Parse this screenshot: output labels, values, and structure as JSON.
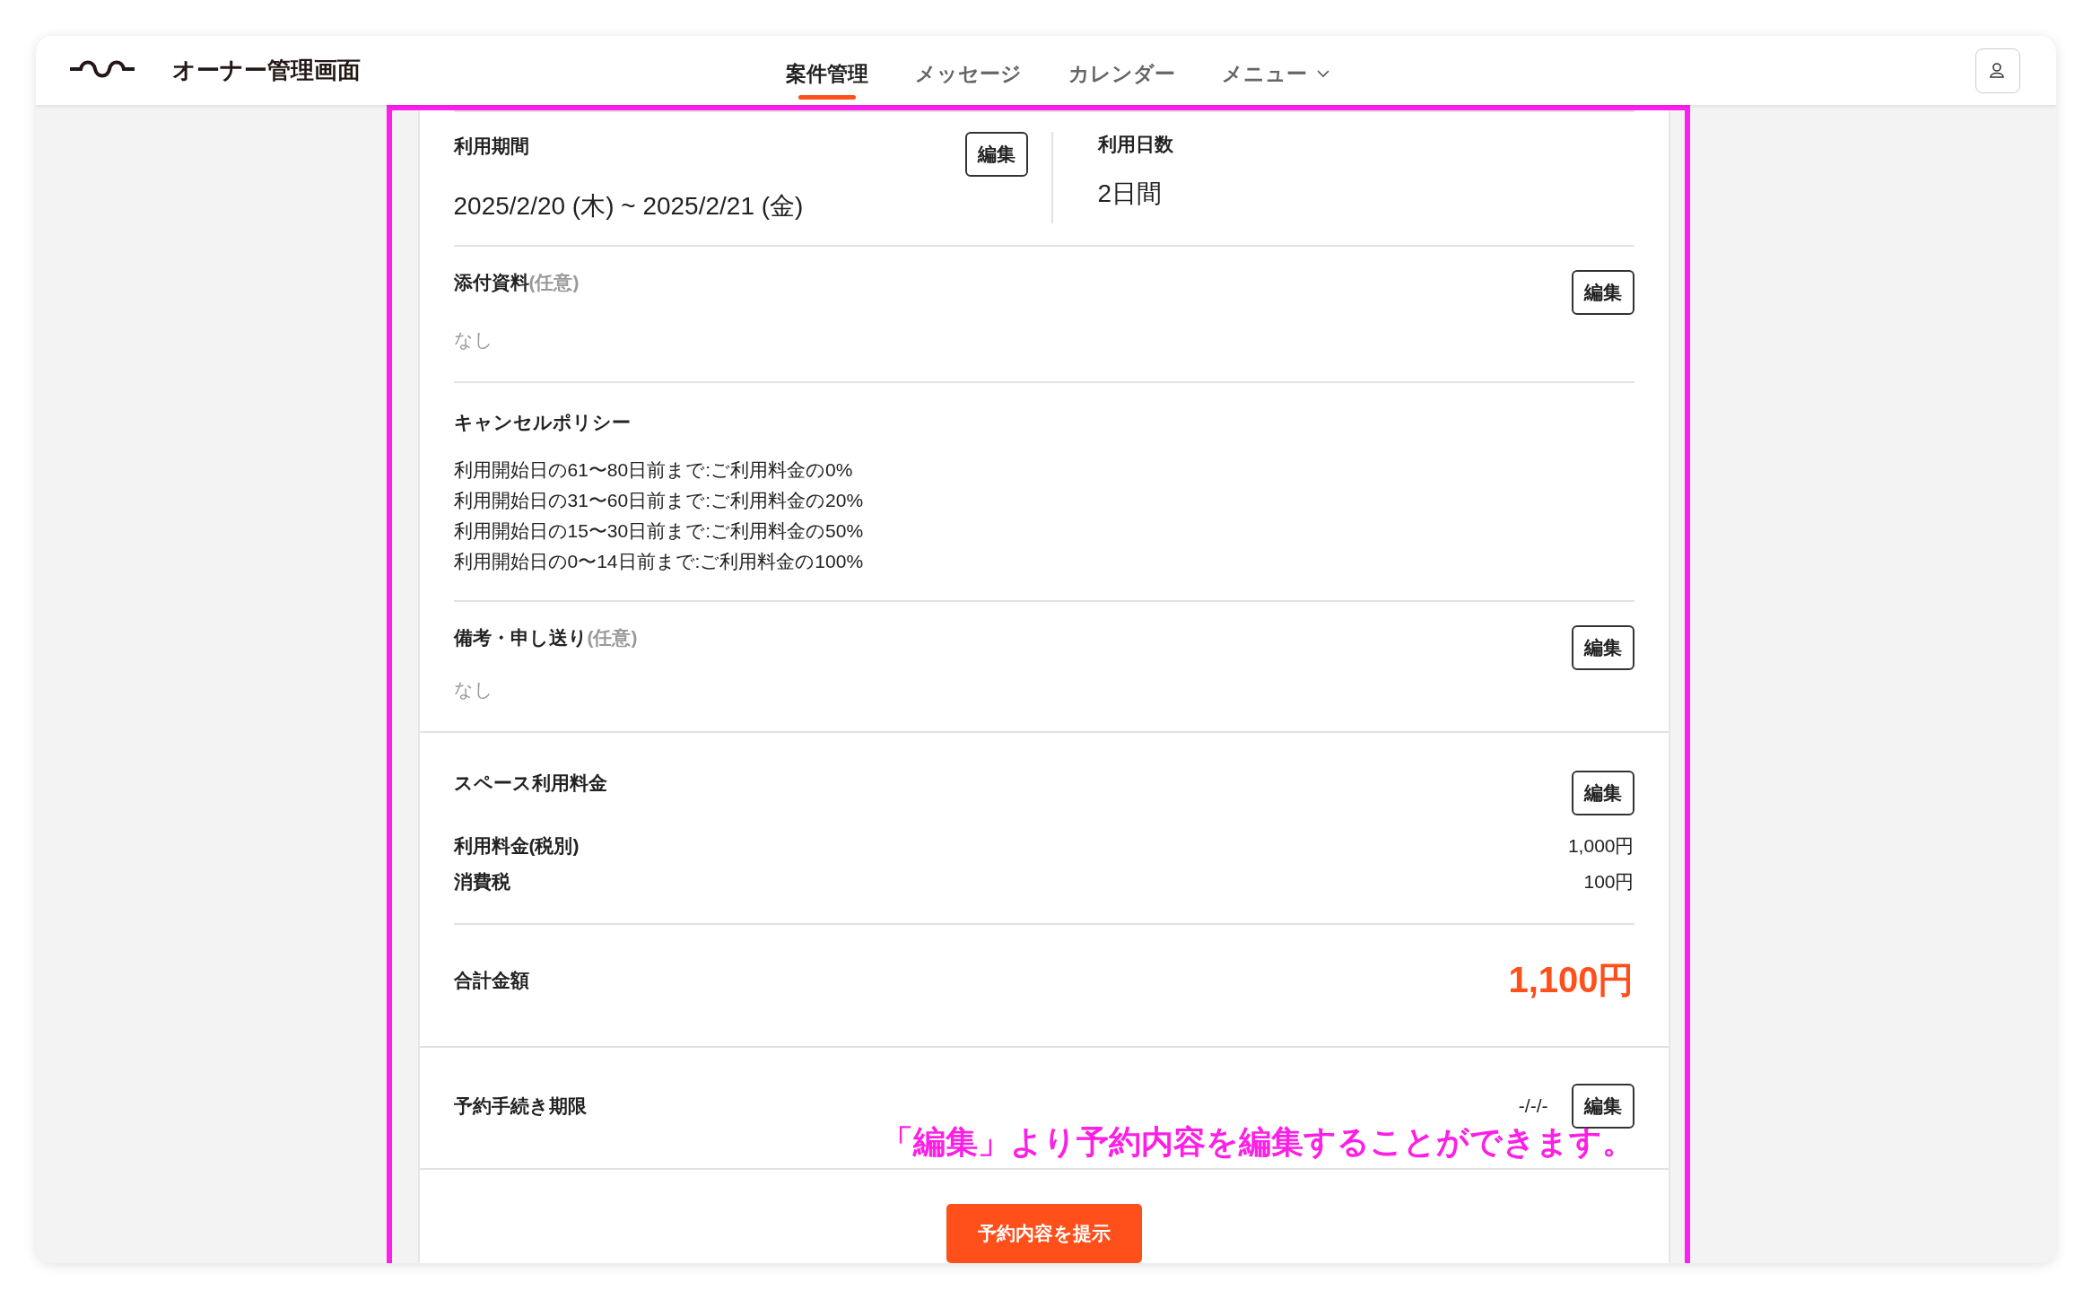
{
  "header": {
    "logo_text": "オーナー管理画面",
    "nav": [
      {
        "label": "案件管理",
        "selected": true,
        "kind": "link"
      },
      {
        "label": "メッセージ",
        "selected": false,
        "kind": "link"
      },
      {
        "label": "カレンダー",
        "selected": false,
        "kind": "link"
      },
      {
        "label": "メニュー",
        "selected": false,
        "kind": "dropdown"
      }
    ]
  },
  "period": {
    "label": "利用期間",
    "value": "2025/2/20 (木) ~ 2025/2/21 (金)",
    "edit": "編集",
    "days_label": "利用日数",
    "days_value": "2日間"
  },
  "attachments": {
    "label": "添付資料",
    "optional": "(任意)",
    "value": "なし",
    "edit": "編集"
  },
  "cancel_policy": {
    "label": "キャンセルポリシー",
    "lines": [
      "利用開始日の61〜80日前まで:ご利用料金の0%",
      "利用開始日の31〜60日前まで:ご利用料金の20%",
      "利用開始日の15〜30日前まで:ご利用料金の50%",
      "利用開始日の0〜14日前まで:ご利用料金の100%"
    ]
  },
  "notes": {
    "label": "備考・申し送り",
    "optional": "(任意)",
    "value": "なし",
    "edit": "編集"
  },
  "fee": {
    "label": "スペース利用料金",
    "edit": "編集",
    "rows": [
      {
        "label": "利用料金(税別)",
        "value": "1,000円"
      },
      {
        "label": "消費税",
        "value": "100円"
      }
    ],
    "total_label": "合計金額",
    "total_value": "1,100円"
  },
  "deadline": {
    "label": "予約手続き期限",
    "value": "-/-/-",
    "edit": "編集"
  },
  "submit": "予約内容を提示",
  "annotation": "「編集」より予約内容を編集することができます。"
}
